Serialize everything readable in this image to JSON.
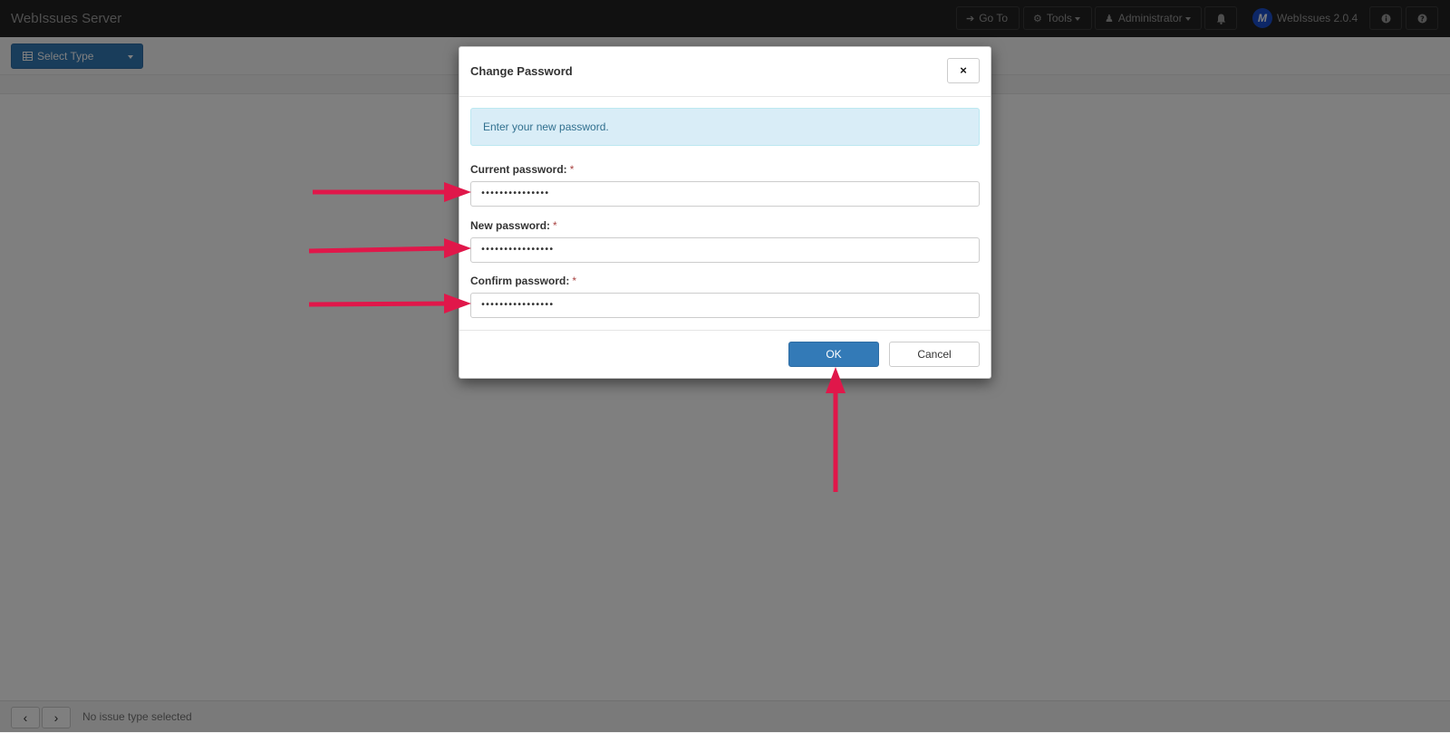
{
  "navbar": {
    "brand": "WebIssues Server",
    "goto_label": "Go To",
    "tools_label": "Tools",
    "user_label": "Administrator",
    "logo_letter": "M",
    "version_label": "WebIssues 2.0.4"
  },
  "toolbar": {
    "select_type_label": "Select Type"
  },
  "footer": {
    "status": "No issue type selected"
  },
  "dialog": {
    "title": "Change Password",
    "close_symbol": "×",
    "info_message": "Enter your new password.",
    "current_password_label": "Current password:",
    "current_password_value": "•••••••••••••••",
    "new_password_label": "New password:",
    "new_password_value": "••••••••••••••••",
    "confirm_password_label": "Confirm password:",
    "confirm_password_value": "••••••••••••••••",
    "required_marker": "*",
    "ok_label": "OK",
    "cancel_label": "Cancel"
  },
  "colors": {
    "primary": "#337ab7",
    "navbar_bg": "#222222",
    "alert_bg": "#d9edf7",
    "annotation_arrow": "#e0174a"
  },
  "icons": [
    "arrow-right-icon",
    "gear-icon",
    "user-icon",
    "bell-icon",
    "info-icon",
    "help-icon",
    "table-icon",
    "chevron-left-icon",
    "chevron-right-icon",
    "close-icon"
  ]
}
